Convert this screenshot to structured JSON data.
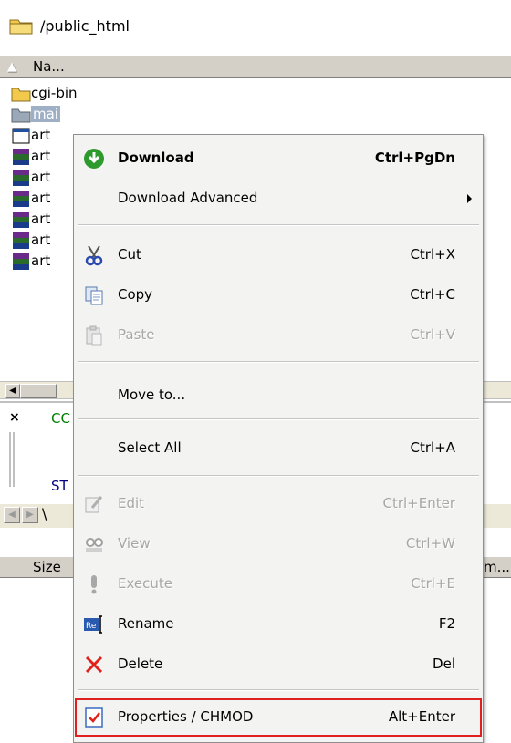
{
  "path": "/public_html",
  "file_list": {
    "column_name": "Na...",
    "items": [
      {
        "label": "cgi-bin",
        "icon": "folder-icon"
      },
      {
        "label": "mai",
        "icon": "folder-icon",
        "selected": true
      },
      {
        "label": "art",
        "icon": "html-file-icon"
      },
      {
        "label": "art",
        "icon": "archive-icon"
      },
      {
        "label": "art",
        "icon": "archive-icon"
      },
      {
        "label": "art",
        "icon": "archive-icon"
      },
      {
        "label": "art",
        "icon": "archive-icon"
      },
      {
        "label": "art",
        "icon": "archive-icon"
      },
      {
        "label": "art",
        "icon": "archive-icon"
      }
    ]
  },
  "log": {
    "line1": "CC",
    "line2": "ST"
  },
  "bottom_header": {
    "size_label": "Size",
    "right_label": "m..."
  },
  "context_menu": {
    "items": [
      {
        "label": "Download",
        "shortcut": "Ctrl+PgDn",
        "icon": "download-icon",
        "bold": true
      },
      {
        "label": "Download Advanced",
        "shortcut": "",
        "icon": "",
        "submenu": true
      },
      {
        "label": "Cut",
        "shortcut": "Ctrl+X",
        "icon": "scissors-icon"
      },
      {
        "label": "Copy",
        "shortcut": "Ctrl+C",
        "icon": "copy-icon"
      },
      {
        "label": "Paste",
        "shortcut": "Ctrl+V",
        "icon": "paste-icon",
        "disabled": true
      },
      {
        "label": "Move to...",
        "shortcut": "",
        "icon": ""
      },
      {
        "label": "Select All",
        "shortcut": "Ctrl+A",
        "icon": ""
      },
      {
        "label": "Edit",
        "shortcut": "Ctrl+Enter",
        "icon": "edit-icon",
        "disabled": true
      },
      {
        "label": "View",
        "shortcut": "Ctrl+W",
        "icon": "view-icon",
        "disabled": true
      },
      {
        "label": "Execute",
        "shortcut": "Ctrl+E",
        "icon": "execute-icon",
        "disabled": true
      },
      {
        "label": "Rename",
        "shortcut": "F2",
        "icon": "rename-icon"
      },
      {
        "label": "Delete",
        "shortcut": "Del",
        "icon": "delete-icon"
      },
      {
        "label": "Properties / CHMOD",
        "shortcut": "Alt+Enter",
        "icon": "properties-icon",
        "highlighted": true
      }
    ]
  },
  "colors": {
    "menu_background": "#f3f3f1",
    "highlight_border": "#e02020",
    "selection": "#9fb0c6",
    "disabled_text": "#a7a7a7"
  }
}
